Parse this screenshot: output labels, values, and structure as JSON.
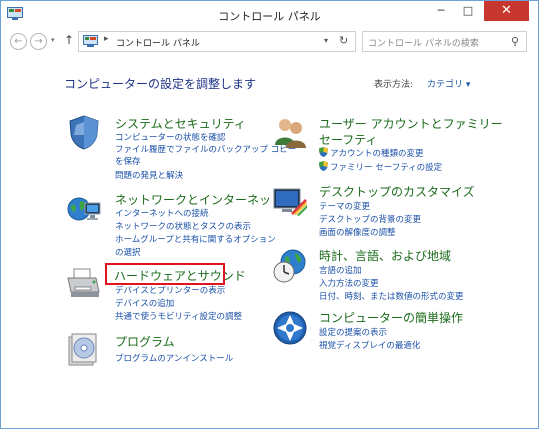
{
  "window": {
    "title": "コントロール パネル"
  },
  "window_buttons": {
    "minimize": "─",
    "maximize": "□",
    "close": "✕"
  },
  "nav": {
    "back": "←",
    "forward": "→",
    "recent": "▾",
    "up": "↑",
    "address_separator": "▸",
    "address": "コントロール パネル",
    "address_dropdown": "▾",
    "refresh": "↻",
    "search_placeholder": "コントロール パネルの検索",
    "search_glyph": "⚲"
  },
  "main": {
    "heading": "コンピューターの設定を調整します",
    "view_by_label": "表示方法:",
    "view_by_value": "カテゴリ ▾"
  },
  "categories": {
    "system": {
      "title": "システムとセキュリティ",
      "links": [
        "コンピューターの状態を確認",
        "ファイル履歴でファイルのバックアップ コピー",
        "を保存",
        "問題の発見と解決"
      ]
    },
    "network": {
      "title": "ネットワークとインターネット",
      "links": [
        "インターネットへの接続",
        "ネットワークの状態とタスクの表示",
        "ホームグループと共有に関するオプション",
        "の選択"
      ]
    },
    "hardware": {
      "title": "ハードウェアとサウンド",
      "links": [
        "デバイスとプリンターの表示",
        "デバイスの追加",
        "共通で使うモビリティ設定の調整"
      ]
    },
    "programs": {
      "title": "プログラム",
      "links": [
        "プログラムのアンインストール"
      ]
    },
    "user_accounts": {
      "title_line1": "ユーザー アカウントとファミリー",
      "title_line2": "セーフティ",
      "links": [
        "アカウントの種類の変更",
        "ファミリー セーフティの設定"
      ]
    },
    "appearance": {
      "title": "デスクトップのカスタマイズ",
      "links": [
        "テーマの変更",
        "デスクトップの背景の変更",
        "画面の解像度の調整"
      ]
    },
    "clock": {
      "title": "時計、言語、および地域",
      "links": [
        "言語の追加",
        "入力方法の変更",
        "日付、時刻、または数値の形式の変更"
      ]
    },
    "ease": {
      "title": "コンピューターの簡単操作",
      "links": [
        "設定の提案の表示",
        "視覚ディスプレイの最適化"
      ]
    }
  },
  "colors": {
    "category_title": "#1c6b1c",
    "link": "#1a4fa8",
    "heading": "#1e3287",
    "highlight_border": "#e0141e",
    "close_button": "#c7372f"
  }
}
